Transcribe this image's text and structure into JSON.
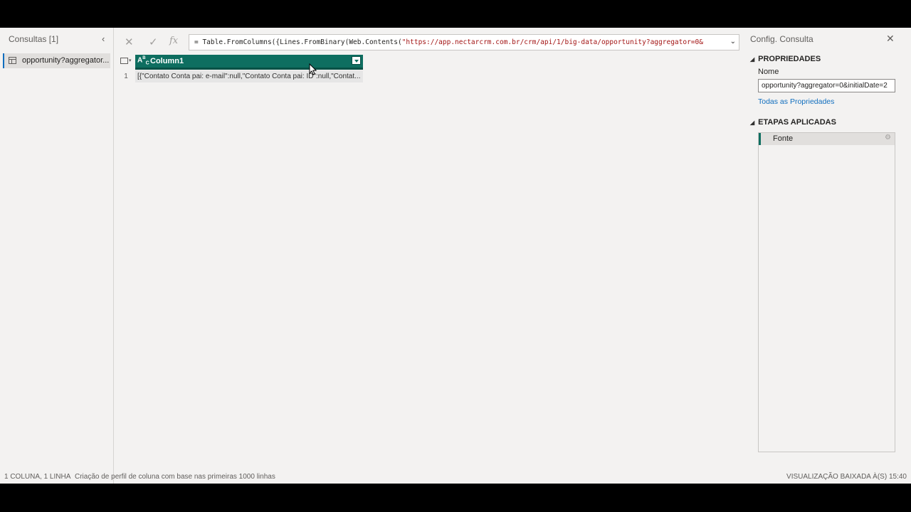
{
  "queries": {
    "title": "Consultas [1]",
    "collapse_icon": "chevron-left-icon",
    "items": [
      {
        "label": "opportunity?aggregator..."
      }
    ]
  },
  "formula_bar": {
    "cancel_icon": "close-icon",
    "commit_icon": "check-icon",
    "fx_label": "fx",
    "prefix": "= Table.FromColumns({Lines.FromBinary(Web.Contents(",
    "url": "\"https://app.nectarcrm.com.br/crm/api/1/big-data/opportunity?aggregator=0&",
    "expand_icon": "chevron-down-icon"
  },
  "grid": {
    "column_type": "ABC",
    "column_name": "Column1",
    "rows": [
      {
        "num": "1",
        "value": "[{\"Contato Conta pai: e-mail\":null,\"Contato Conta pai: ID\":null,\"Contat..."
      }
    ]
  },
  "settings": {
    "title": "Config. Consulta",
    "close_icon": "close-icon",
    "properties_heading": "PROPRIEDADES",
    "name_label": "Nome",
    "name_value": "opportunity?aggregator=0&initialDate=2",
    "all_properties_link": "Todas as Propriedades",
    "steps_heading": "ETAPAS APLICADAS",
    "steps": [
      {
        "label": "Fonte"
      }
    ]
  },
  "status": {
    "counts": "1 COLUNA, 1 LINHA",
    "profiling": "Criação de perfil de coluna com base nas primeiras 1000 linhas",
    "preview": "VISUALIZAÇÃO BAIXADA À(S) 15:40"
  }
}
